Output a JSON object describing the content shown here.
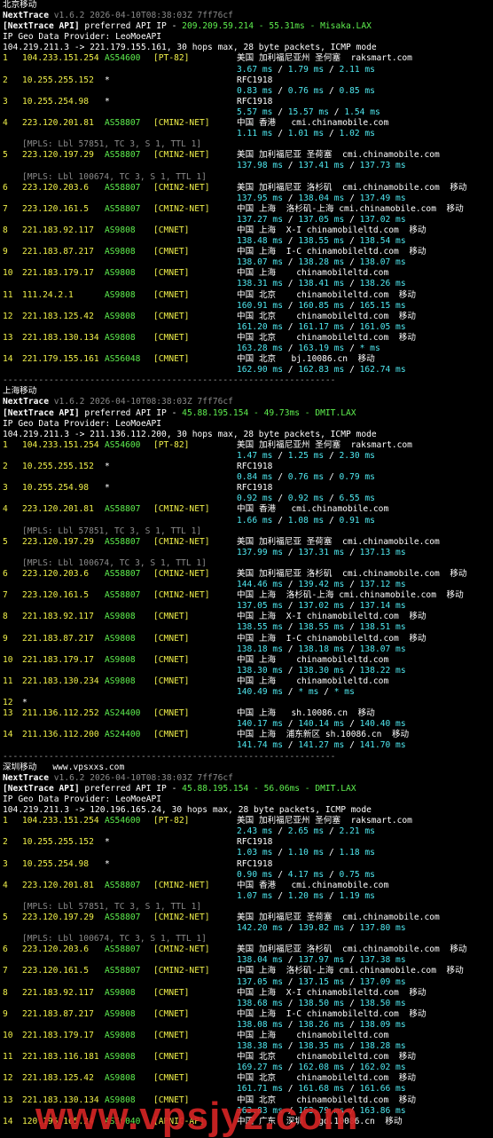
{
  "sections": [
    {
      "title": "北京移动",
      "site": "",
      "header": {
        "app": "NextTrace",
        "version": "v1.6.2 2026-04-10T08:38:03Z 7ff76cf",
        "api_label": "[NextTrace API]",
        "api_mid": " preferred API IP - ",
        "api_ip": "209.209.59.214 - 55.31ms - Misaka.LAX",
        "geo": "IP Geo Data Provider: LeoMoeAPI",
        "route": "104.219.211.3 -> 221.179.155.161, 30 hops max, 28 byte packets, ICMP mode"
      },
      "hops": [
        {
          "n": "1",
          "ip": "104.233.151.254",
          "asn": "AS54600",
          "tag": "[PT-82]",
          "geo": "美国 加利福尼亚州 圣何塞  raksmart.com",
          "lat": [
            "3.67 ms",
            "1.79 ms",
            "2.11 ms"
          ]
        },
        {
          "n": "2",
          "ip": "10.255.255.152",
          "star": "*",
          "geo": "RFC1918",
          "lat": [
            "0.83 ms",
            "0.76 ms",
            "0.85 ms"
          ]
        },
        {
          "n": "3",
          "ip": "10.255.254.98",
          "star": "*",
          "geo": "RFC1918",
          "lat": [
            "5.57 ms",
            "15.57 ms",
            "1.54 ms"
          ]
        },
        {
          "n": "4",
          "ip": "223.120.201.81",
          "asn": "AS58807",
          "tag": "[CMIN2-NET]",
          "geo": "中国 香港   cmi.chinamobile.com",
          "lat": [
            "1.11 ms",
            "1.01 ms",
            "1.02 ms"
          ]
        },
        {
          "n": "5",
          "ip": "223.120.197.29",
          "asn": "AS58807",
          "tag": "[CMIN2-NET]",
          "geo": "美国 加利福尼亚 圣荷塞  cmi.chinamobile.com",
          "lat": [
            "137.98 ms",
            "137.41 ms",
            "137.73 ms"
          ],
          "mpls": [
            "[MPLS: Lbl 57851, TC 3, S 1, TTL 1]"
          ]
        },
        {
          "n": "6",
          "ip": "223.120.203.6",
          "asn": "AS58807",
          "tag": "[CMIN2-NET]",
          "geo": "美国 加利福尼亚 洛杉矶  cmi.chinamobile.com  移动",
          "lat": [
            "137.95 ms",
            "138.04 ms",
            "137.49 ms"
          ],
          "mpls": [
            "[MPLS: Lbl 100674, TC 3, S 1, TTL 1]"
          ]
        },
        {
          "n": "7",
          "ip": "223.120.161.5",
          "asn": "AS58807",
          "tag": "[CMIN2-NET]",
          "geo": "中国 上海  洛杉矶-上海 cmi.chinamobile.com  移动",
          "lat": [
            "137.27 ms",
            "137.05 ms",
            "137.02 ms"
          ]
        },
        {
          "n": "8",
          "ip": "221.183.92.117",
          "asn": "AS9808",
          "tag": "[CMNET]",
          "geo": "中国 上海  X-I chinamobileltd.com  移动",
          "lat": [
            "138.48 ms",
            "138.55 ms",
            "138.54 ms"
          ]
        },
        {
          "n": "9",
          "ip": "221.183.87.217",
          "asn": "AS9808",
          "tag": "[CMNET]",
          "geo": "中国 上海  I-C chinamobileltd.com  移动",
          "lat": [
            "138.07 ms",
            "138.28 ms",
            "138.07 ms"
          ]
        },
        {
          "n": "10",
          "ip": "221.183.179.17",
          "asn": "AS9808",
          "tag": "[CMNET]",
          "geo": "中国 上海    chinamobileltd.com",
          "lat": [
            "138.31 ms",
            "138.41 ms",
            "138.26 ms"
          ]
        },
        {
          "n": "11",
          "ip": "111.24.2.1",
          "asn": "AS9808",
          "tag": "[CMNET]",
          "geo": "中国 北京    chinamobileltd.com  移动",
          "lat": [
            "160.91 ms",
            "160.85 ms",
            "165.15 ms"
          ]
        },
        {
          "n": "12",
          "ip": "221.183.125.42",
          "asn": "AS9808",
          "tag": "[CMNET]",
          "geo": "中国 北京    chinamobileltd.com  移动",
          "lat": [
            "161.20 ms",
            "161.17 ms",
            "161.05 ms"
          ]
        },
        {
          "n": "13",
          "ip": "221.183.130.134",
          "asn": "AS9808",
          "tag": "[CMNET]",
          "geo": "中国 北京    chinamobileltd.com  移动",
          "lat": [
            "163.28 ms",
            "163.19 ms",
            "* ms"
          ]
        },
        {
          "n": "14",
          "ip": "221.179.155.161",
          "asn": "AS56048",
          "tag": "[CMNET]",
          "geo": "中国 北京   bj.10086.cn  移动",
          "lat": [
            "162.90 ms",
            "162.83 ms",
            "162.74 ms"
          ]
        }
      ]
    },
    {
      "title": "上海移动",
      "site": "",
      "header": {
        "app": "NextTrace",
        "version": "v1.6.2 2026-04-10T08:38:03Z 7ff76cf",
        "api_label": "[NextTrace API]",
        "api_mid": " preferred API IP - ",
        "api_ip": "45.88.195.154 - 49.73ms - DMIT.LAX",
        "geo": "IP Geo Data Provider: LeoMoeAPI",
        "route": "104.219.211.3 -> 211.136.112.200, 30 hops max, 28 byte packets, ICMP mode"
      },
      "hops": [
        {
          "n": "1",
          "ip": "104.233.151.254",
          "asn": "AS54600",
          "tag": "[PT-82]",
          "geo": "美国 加利福尼亚州 圣何塞  raksmart.com",
          "lat": [
            "1.47 ms",
            "1.25 ms",
            "2.30 ms"
          ]
        },
        {
          "n": "2",
          "ip": "10.255.255.152",
          "star": "*",
          "geo": "RFC1918",
          "lat": [
            "0.84 ms",
            "0.76 ms",
            "0.79 ms"
          ]
        },
        {
          "n": "3",
          "ip": "10.255.254.98",
          "star": "*",
          "geo": "RFC1918",
          "lat": [
            "0.92 ms",
            "0.92 ms",
            "6.55 ms"
          ]
        },
        {
          "n": "4",
          "ip": "223.120.201.81",
          "asn": "AS58807",
          "tag": "[CMIN2-NET]",
          "geo": "中国 香港   cmi.chinamobile.com",
          "lat": [
            "1.66 ms",
            "1.08 ms",
            "0.91 ms"
          ]
        },
        {
          "n": "5",
          "ip": "223.120.197.29",
          "asn": "AS58807",
          "tag": "[CMIN2-NET]",
          "geo": "美国 加利福尼亚 圣荷塞  cmi.chinamobile.com",
          "lat": [
            "137.99 ms",
            "137.31 ms",
            "137.13 ms"
          ],
          "mpls": [
            "[MPLS: Lbl 57851, TC 3, S 1, TTL 1]"
          ]
        },
        {
          "n": "6",
          "ip": "223.120.203.6",
          "asn": "AS58807",
          "tag": "[CMIN2-NET]",
          "geo": "美国 加利福尼亚 洛杉矶  cmi.chinamobile.com  移动",
          "lat": [
            "144.46 ms",
            "139.42 ms",
            "137.12 ms"
          ],
          "mpls": [
            "[MPLS: Lbl 100674, TC 3, S 1, TTL 1]"
          ]
        },
        {
          "n": "7",
          "ip": "223.120.161.5",
          "asn": "AS58807",
          "tag": "[CMIN2-NET]",
          "geo": "中国 上海  洛杉矶-上海 cmi.chinamobile.com  移动",
          "lat": [
            "137.05 ms",
            "137.02 ms",
            "137.14 ms"
          ]
        },
        {
          "n": "8",
          "ip": "221.183.92.117",
          "asn": "AS9808",
          "tag": "[CMNET]",
          "geo": "中国 上海  X-I chinamobileltd.com  移动",
          "lat": [
            "138.55 ms",
            "138.55 ms",
            "138.51 ms"
          ]
        },
        {
          "n": "9",
          "ip": "221.183.87.217",
          "asn": "AS9808",
          "tag": "[CMNET]",
          "geo": "中国 上海  I-C chinamobileltd.com  移动",
          "lat": [
            "138.18 ms",
            "138.18 ms",
            "138.07 ms"
          ]
        },
        {
          "n": "10",
          "ip": "221.183.179.17",
          "asn": "AS9808",
          "tag": "[CMNET]",
          "geo": "中国 上海    chinamobileltd.com",
          "lat": [
            "138.30 ms",
            "138.30 ms",
            "138.22 ms"
          ]
        },
        {
          "n": "11",
          "ip": "221.183.130.234",
          "asn": "AS9808",
          "tag": "[CMNET]",
          "geo": "中国 上海    chinamobileltd.com",
          "lat": [
            "140.49 ms",
            "* ms",
            "* ms"
          ]
        },
        {
          "n": "12",
          "ip": "*",
          "single": true
        },
        {
          "n": "13",
          "ip": "211.136.112.252",
          "asn": "AS24400",
          "tag": "[CMNET]",
          "geo": "中国 上海   sh.10086.cn  移动",
          "lat": [
            "140.17 ms",
            "140.14 ms",
            "140.40 ms"
          ]
        },
        {
          "n": "14",
          "ip": "211.136.112.200",
          "asn": "AS24400",
          "tag": "[CMNET]",
          "geo": "中国 上海  浦东新区 sh.10086.cn  移动",
          "lat": [
            "141.74 ms",
            "141.27 ms",
            "141.70 ms"
          ]
        }
      ]
    },
    {
      "title": "深圳移动",
      "site": "www.vpsxxs.com",
      "header": {
        "app": "NextTrace",
        "version": "v1.6.2 2026-04-10T08:38:03Z 7ff76cf",
        "api_label": "[NextTrace API]",
        "api_mid": " preferred API IP - ",
        "api_ip": "45.88.195.154 - 56.06ms - DMIT.LAX",
        "geo": "IP Geo Data Provider: LeoMoeAPI",
        "route": "104.219.211.3 -> 120.196.165.24, 30 hops max, 28 byte packets, ICMP mode"
      },
      "hops": [
        {
          "n": "1",
          "ip": "104.233.151.254",
          "asn": "AS54600",
          "tag": "[PT-82]",
          "geo": "美国 加利福尼亚州 圣何塞  raksmart.com",
          "lat": [
            "2.43 ms",
            "2.65 ms",
            "2.21 ms"
          ]
        },
        {
          "n": "2",
          "ip": "10.255.255.152",
          "star": "*",
          "geo": "RFC1918",
          "lat": [
            "1.03 ms",
            "1.10 ms",
            "1.18 ms"
          ]
        },
        {
          "n": "3",
          "ip": "10.255.254.98",
          "star": "*",
          "geo": "RFC1918",
          "lat": [
            "0.90 ms",
            "4.17 ms",
            "0.75 ms"
          ]
        },
        {
          "n": "4",
          "ip": "223.120.201.81",
          "asn": "AS58807",
          "tag": "[CMIN2-NET]",
          "geo": "中国 香港   cmi.chinamobile.com",
          "lat": [
            "1.07 ms",
            "1.20 ms",
            "1.19 ms"
          ]
        },
        {
          "n": "5",
          "ip": "223.120.197.29",
          "asn": "AS58807",
          "tag": "[CMIN2-NET]",
          "geo": "美国 加利福尼亚 圣荷塞  cmi.chinamobile.com",
          "lat": [
            "142.20 ms",
            "139.82 ms",
            "137.80 ms"
          ],
          "mpls": [
            "[MPLS: Lbl 57851, TC 3, S 1, TTL 1]"
          ]
        },
        {
          "n": "6",
          "ip": "223.120.203.6",
          "asn": "AS58807",
          "tag": "[CMIN2-NET]",
          "geo": "美国 加利福尼亚 洛杉矶  cmi.chinamobile.com  移动",
          "lat": [
            "138.04 ms",
            "137.97 ms",
            "137.38 ms"
          ],
          "mpls": [
            "[MPLS: Lbl 100674, TC 3, S 1, TTL 1]"
          ]
        },
        {
          "n": "7",
          "ip": "223.120.161.5",
          "asn": "AS58807",
          "tag": "[CMIN2-NET]",
          "geo": "中国 上海  洛杉矶-上海 cmi.chinamobile.com  移动",
          "lat": [
            "137.05 ms",
            "137.15 ms",
            "137.09 ms"
          ]
        },
        {
          "n": "8",
          "ip": "221.183.92.117",
          "asn": "AS9808",
          "tag": "[CMNET]",
          "geo": "中国 上海  X-I chinamobileltd.com  移动",
          "lat": [
            "138.68 ms",
            "138.50 ms",
            "138.50 ms"
          ]
        },
        {
          "n": "9",
          "ip": "221.183.87.217",
          "asn": "AS9808",
          "tag": "[CMNET]",
          "geo": "中国 上海  I-C chinamobileltd.com  移动",
          "lat": [
            "138.08 ms",
            "138.26 ms",
            "138.09 ms"
          ]
        },
        {
          "n": "10",
          "ip": "221.183.179.17",
          "asn": "AS9808",
          "tag": "[CMNET]",
          "geo": "中国 上海    chinamobileltd.com",
          "lat": [
            "138.38 ms",
            "138.35 ms",
            "138.28 ms"
          ]
        },
        {
          "n": "11",
          "ip": "221.183.116.181",
          "asn": "AS9808",
          "tag": "[CMNET]",
          "geo": "中国 北京    chinamobileltd.com  移动",
          "lat": [
            "169.27 ms",
            "162.08 ms",
            "162.02 ms"
          ]
        },
        {
          "n": "12",
          "ip": "221.183.125.42",
          "asn": "AS9808",
          "tag": "[CMNET]",
          "geo": "中国 北京    chinamobileltd.com  移动",
          "lat": [
            "161.71 ms",
            "161.68 ms",
            "161.66 ms"
          ]
        },
        {
          "n": "13",
          "ip": "221.183.130.134",
          "asn": "AS9808",
          "tag": "[CMNET]",
          "geo": "中国 北京    chinamobileltd.com  移动",
          "lat": [
            "163.83 ms",
            "163.79 ms",
            "163.86 ms"
          ]
        },
        {
          "n": "14",
          "ip": "120.196.165.24",
          "asn": "AS56040",
          "tag": "[APNIC-AP]",
          "geo": "中国 广东  深圳   gd.10086.cn  移动",
          "lat": []
        }
      ]
    }
  ],
  "separator": "-----------------------------------------------------------------",
  "watermark": "www.vpsjyz.com",
  "colors": {
    "background": "#000000",
    "ip": "#f0f04a",
    "asn": "#5ff04f",
    "latency": "#4fe8f0",
    "mpls": "#8a8a8a",
    "watermark": "#d42424"
  }
}
